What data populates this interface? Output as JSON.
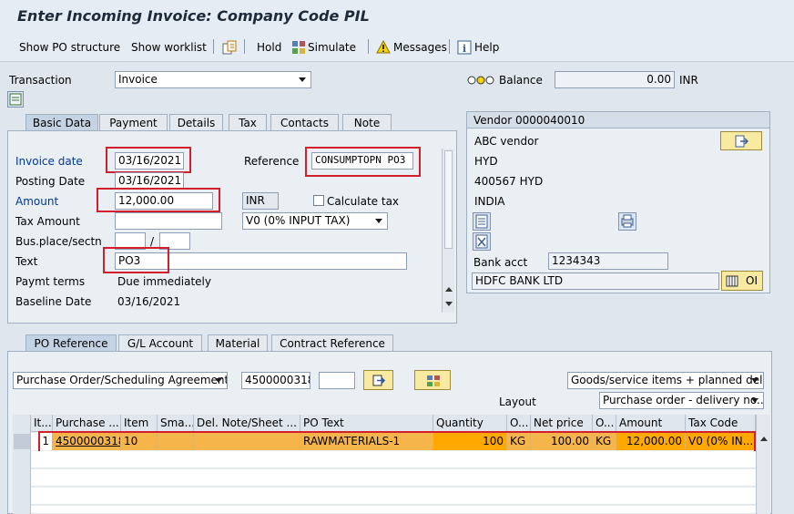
{
  "window": {
    "title": "Enter Incoming Invoice: Company Code PIL"
  },
  "toolbar": {
    "show_po_structure": "Show PO structure",
    "show_worklist": "Show worklist",
    "hold": "Hold",
    "simulate": "Simulate",
    "messages": "Messages",
    "help": "Help"
  },
  "header": {
    "transaction_label": "Transaction",
    "transaction_value": "Invoice",
    "balance_label": "Balance",
    "balance_value": "0.00",
    "balance_currency": "INR"
  },
  "basic_tabs": [
    "Basic Data",
    "Payment",
    "Details",
    "Tax",
    "Contacts",
    "Note"
  ],
  "basic": {
    "invoice_date_label": "Invoice date",
    "invoice_date": "03/16/2021",
    "reference_label": "Reference",
    "reference": "CONSUMPTOPN PO3",
    "posting_date_label": "Posting Date",
    "posting_date": "03/16/2021",
    "amount_label": "Amount",
    "amount": "12,000.00",
    "currency": "INR",
    "calculate_tax_label": "Calculate tax",
    "tax_amount_label": "Tax Amount",
    "tax_code": "V0 (0% INPUT TAX)",
    "bus_place_label": "Bus.place/sectn",
    "slash": "/",
    "text_label": "Text",
    "text": "PO3",
    "paymt_terms_label": "Paymt terms",
    "paymt_terms": "Due immediately",
    "baseline_date_label": "Baseline Date",
    "baseline_date": "03/16/2021"
  },
  "vendor": {
    "title": "Vendor 0000040010",
    "name": "ABC vendor",
    "city": "HYD",
    "postal": "400567 HYD",
    "country": "INDIA",
    "bank_acct_label": "Bank acct",
    "bank_acct": "1234343",
    "bank_name": "HDFC BANK LTD",
    "oi_label": "OI"
  },
  "po_tabs": [
    "PO Reference",
    "G/L Account",
    "Material",
    "Contract Reference"
  ],
  "po_ref": {
    "ref_type": "Purchase Order/Scheduling Agreement",
    "po_number": "4500000318",
    "goods_select": "Goods/service items + planned deli...",
    "layout_label": "Layout",
    "layout_select": "Purchase order - delivery no..."
  },
  "grid": {
    "headers": [
      "It...",
      "Purchase ...",
      "Item",
      "Sma...",
      "Del. Note/Sheet ...",
      "PO Text",
      "Quantity",
      "O...",
      "Net price",
      "O...",
      "Amount",
      "Tax Code"
    ],
    "row": [
      "1",
      "4500000318",
      "10",
      "",
      "",
      "RAWMATERIALS-1",
      "100",
      "KG",
      "100.00",
      "KG",
      "12,000.00",
      "V0 (0% IN..."
    ]
  },
  "colors": {
    "highlight_row": "#f5b54b",
    "selected_cell": "#ffa800",
    "annotation_red": "#d21f2b",
    "link_blue": "#0036a0"
  }
}
